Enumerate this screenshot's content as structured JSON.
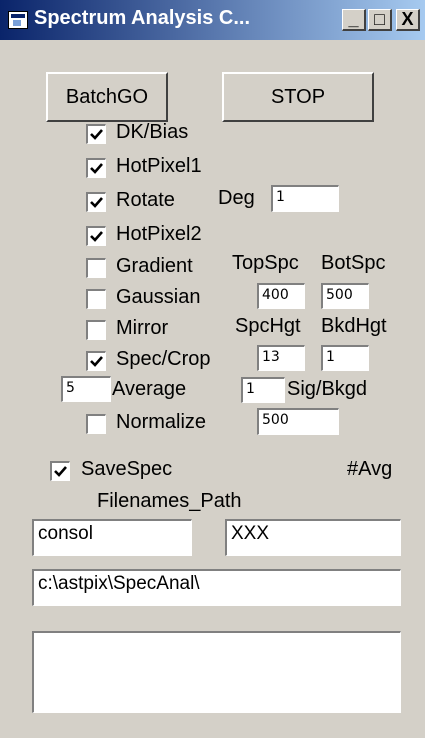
{
  "window": {
    "title": "Spectrum Analysis C...",
    "minimize_glyph": "_",
    "maximize_glyph": "□",
    "close_glyph": "X"
  },
  "buttons": {
    "batchgo": "BatchGO",
    "stop": "STOP"
  },
  "checkboxes": [
    {
      "label": "DK/Bias",
      "checked": true
    },
    {
      "label": "HotPixel1",
      "checked": true
    },
    {
      "label": "Rotate",
      "checked": true
    },
    {
      "label": "HotPixel2",
      "checked": true
    },
    {
      "label": "Gradient",
      "checked": false
    },
    {
      "label": "Gaussian",
      "checked": false
    },
    {
      "label": "Mirror",
      "checked": false
    },
    {
      "label": "Spec/Crop",
      "checked": true
    },
    {
      "label": "Normalize",
      "checked": false
    },
    {
      "label": "SaveSpec",
      "checked": true
    }
  ],
  "labels": {
    "deg": "Deg",
    "topspc": "TopSpc",
    "botspc": "BotSpc",
    "spchgt": "SpcHgt",
    "bkdhgt": "BkdHgt",
    "average": "Average",
    "sigbkgd": "Sig/Bkgd",
    "navg": "#Avg",
    "filenames_path": "Filenames_Path"
  },
  "fields": {
    "deg": "1",
    "topspc": "400",
    "botspc": "500",
    "spchgt": "13",
    "bkdhgt": "1",
    "average": "5",
    "sigbkgd": "1",
    "normalize": "500",
    "filename1": "consol",
    "filename2": "XXX",
    "path": "c:\\astpix\\SpecAnal\\",
    "output": ""
  }
}
